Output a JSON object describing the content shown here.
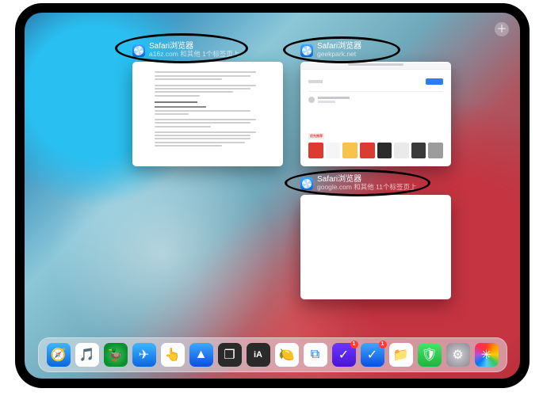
{
  "add_button_glyph": "＋",
  "cards": [
    {
      "title": "Safari浏览器",
      "subtitle": "a16z.com 和其他 1个标签页上"
    },
    {
      "title": "Safari浏览器",
      "subtitle": "geekpark.net"
    },
    {
      "title": "Safari浏览器",
      "subtitle": "google.com 和其他 11个标签页上"
    }
  ],
  "thumb2": {
    "strip_label": "优先推荐",
    "tiles": [
      "#dc3b2f",
      "#f5f5f7",
      "#f6c44a",
      "#dc3b2f",
      "#2b2b2b",
      "#eaeaea",
      "#3a3a3a",
      "#9c9c9c"
    ]
  },
  "dock": [
    {
      "name": "safari",
      "bg": "linear-gradient(180deg,#3fb6ff,#0a66e0)",
      "glyph": "🧭"
    },
    {
      "name": "music",
      "bg": "#ffffff",
      "glyph": "🎵"
    },
    {
      "name": "browser2",
      "bg": "radial-gradient(circle at 50% 50%,#35c759,#0a8f2f 70%)",
      "glyph": "🦆"
    },
    {
      "name": "telegram",
      "bg": "linear-gradient(180deg,#3fb6ff,#0a66e0)",
      "glyph": "✈"
    },
    {
      "name": "touchid",
      "bg": "#ffffff",
      "glyph": "👆"
    },
    {
      "name": "nav",
      "bg": "linear-gradient(180deg,#3fa8ff,#0a4fe0)",
      "glyph": "▲"
    },
    {
      "name": "switcher",
      "bg": "#2a2a2a",
      "glyph": "❐"
    },
    {
      "name": "ia",
      "bg": "#2a2a2a",
      "glyph": "iA"
    },
    {
      "name": "leaf",
      "bg": "#ffffff",
      "glyph": "🍋"
    },
    {
      "name": "dropbox",
      "bg": "#ffffff",
      "glyph": "⧉"
    },
    {
      "name": "things",
      "bg": "linear-gradient(180deg,#6a38ff,#4a12d8)",
      "glyph": "✓",
      "badge": "1"
    },
    {
      "name": "clock",
      "bg": "linear-gradient(180deg,#3fa8ff,#0a4fe0)",
      "glyph": "✓",
      "badge": "1"
    },
    {
      "name": "files",
      "bg": "#ffffff",
      "glyph": "📁"
    },
    {
      "name": "shield",
      "bg": "linear-gradient(180deg,#4be36a,#19b63e)",
      "glyph": "🛡"
    },
    {
      "name": "settings",
      "bg": "radial-gradient(circle,#cfcfd4,#8a8a92)",
      "glyph": "⚙"
    },
    {
      "name": "photos",
      "bg": "#ffffff",
      "glyph": "✳"
    }
  ]
}
